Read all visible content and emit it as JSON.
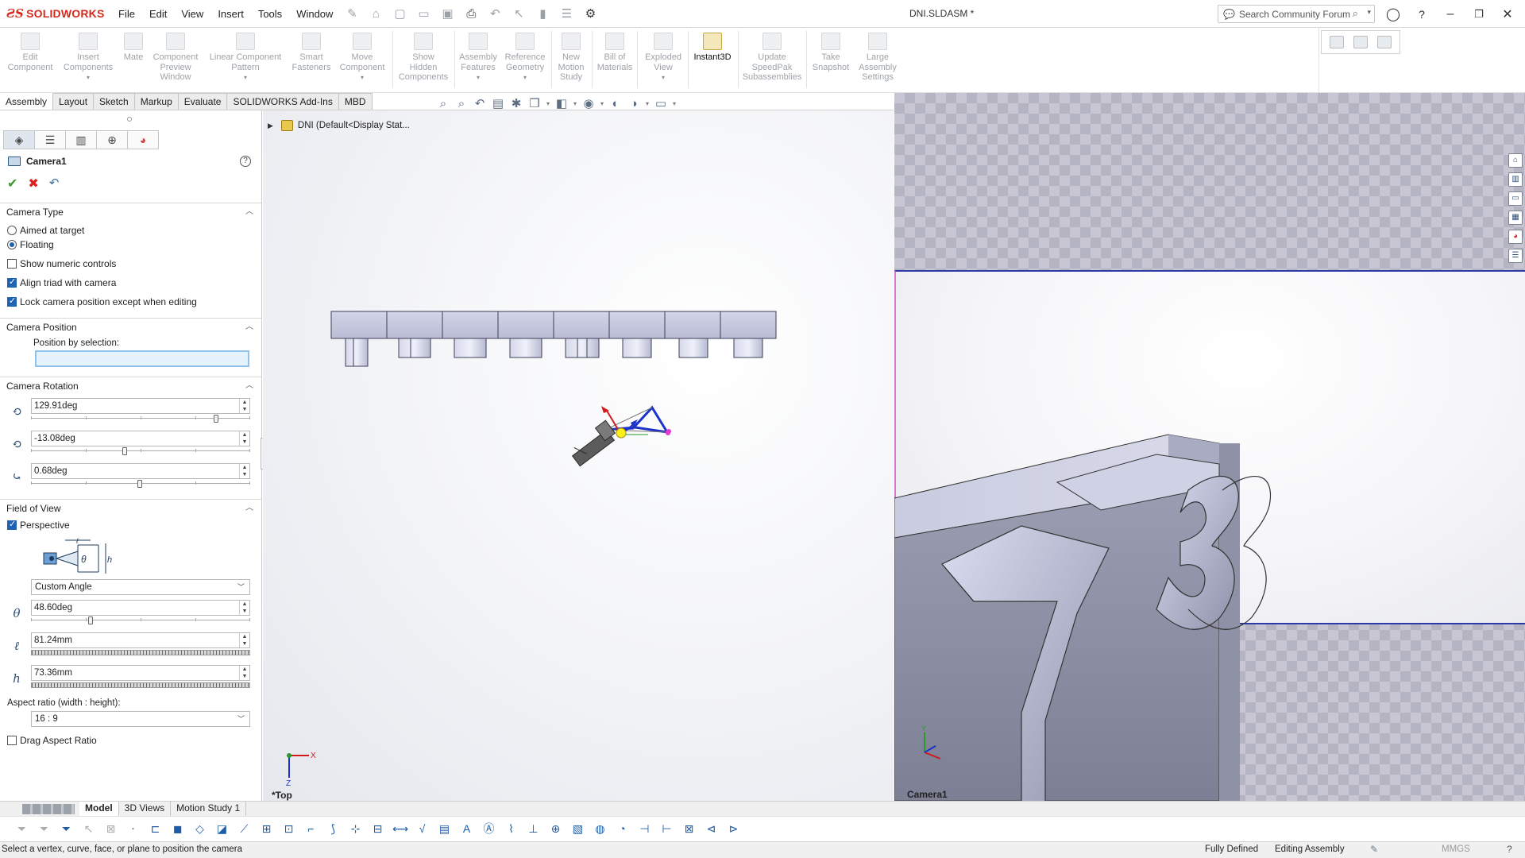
{
  "app": {
    "logo_text": "SOLIDWORKS",
    "document_title": "DNI.SLDASM *",
    "menu": [
      "File",
      "Edit",
      "View",
      "Insert",
      "Tools",
      "Window"
    ],
    "search_placeholder": "Search Community Forum"
  },
  "ribbon": {
    "buttons": [
      {
        "label1": "Edit",
        "label2": "Component",
        "label3": "",
        "dropdown": false
      },
      {
        "label1": "Insert",
        "label2": "Components",
        "label3": "",
        "dropdown": true
      },
      {
        "label1": "Mate",
        "label2": "",
        "label3": "",
        "dropdown": false
      },
      {
        "label1": "Component",
        "label2": "Preview",
        "label3": "Window",
        "dropdown": false
      },
      {
        "label1": "Linear Component",
        "label2": "Pattern",
        "label3": "",
        "dropdown": true
      },
      {
        "label1": "Smart",
        "label2": "Fasteners",
        "label3": "",
        "dropdown": false
      },
      {
        "label1": "Move",
        "label2": "Component",
        "label3": "",
        "dropdown": true
      },
      {
        "label1": "Show",
        "label2": "Hidden",
        "label3": "Components",
        "dropdown": false
      },
      {
        "label1": "Assembly",
        "label2": "Features",
        "label3": "",
        "dropdown": true
      },
      {
        "label1": "Reference",
        "label2": "Geometry",
        "label3": "",
        "dropdown": true
      },
      {
        "label1": "New",
        "label2": "Motion",
        "label3": "Study",
        "dropdown": false
      },
      {
        "label1": "Bill of",
        "label2": "Materials",
        "label3": "",
        "dropdown": false
      },
      {
        "label1": "Exploded",
        "label2": "View",
        "label3": "",
        "dropdown": true
      },
      {
        "label1": "Instant3D",
        "label2": "",
        "label3": "",
        "dropdown": false
      },
      {
        "label1": "Update",
        "label2": "SpeedPak",
        "label3": "Subassemblies",
        "dropdown": false
      },
      {
        "label1": "Take",
        "label2": "Snapshot",
        "label3": "",
        "dropdown": false
      },
      {
        "label1": "Large",
        "label2": "Assembly",
        "label3": "Settings",
        "dropdown": false
      }
    ]
  },
  "tabs": [
    "Assembly",
    "Layout",
    "Sketch",
    "Markup",
    "Evaluate",
    "SOLIDWORKS Add-Ins",
    "MBD"
  ],
  "active_tab": "Assembly",
  "property_manager": {
    "title": "Camera1",
    "camera_type": {
      "header": "Camera Type",
      "aimed_label": "Aimed at target",
      "floating_label": "Floating",
      "selected": "Floating",
      "show_numeric_label": "Show numeric controls",
      "show_numeric": false,
      "align_triad_label": "Align triad with camera",
      "align_triad": true,
      "lock_position_label": "Lock camera position except when editing",
      "lock_position": true
    },
    "camera_position": {
      "header": "Camera Position",
      "position_label": "Position by selection:",
      "position_value": ""
    },
    "camera_rotation": {
      "header": "Camera Rotation",
      "yaw": "129.91deg",
      "pitch": "-13.08deg",
      "roll": "0.68deg"
    },
    "field_of_view": {
      "header": "Field of View",
      "perspective_label": "Perspective",
      "perspective": true,
      "angle_mode": "Custom Angle",
      "theta_symbol": "θ",
      "theta": "48.60deg",
      "l_symbol": "ℓ",
      "length": "81.24mm",
      "h_symbol": "h",
      "height": "73.36mm",
      "aspect_label": "Aspect ratio (width : height):",
      "aspect": "16 : 9",
      "drag_aspect_label": "Drag Aspect Ratio",
      "drag_aspect": false
    }
  },
  "graphics": {
    "tree_flyout": "DNI  (Default<Display Stat...",
    "view_label": "*Top",
    "triad_x": "X",
    "triad_z": "Z"
  },
  "camera_view": {
    "label": "Camera1",
    "triad_y": "Y"
  },
  "bottom_tabs": [
    "Model",
    "3D Views",
    "Motion Study 1"
  ],
  "active_bottom_tab": "Model",
  "status": {
    "message": "Select a vertex, curve, face, or plane to position the camera",
    "definition": "Fully Defined",
    "mode": "Editing Assembly",
    "units": "MMGS"
  },
  "colors": {
    "accent": "#1e62b0",
    "logo": "#d52b1e",
    "camera_frame": "#2d3aa5",
    "ok": "#3c9a2c",
    "cancel": "#dd2222"
  }
}
